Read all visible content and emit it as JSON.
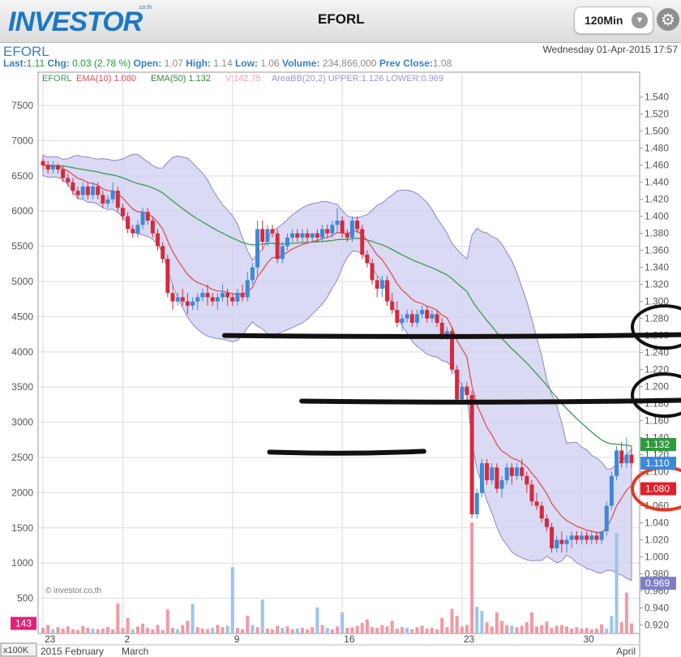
{
  "app": {
    "logo": "INVESTOR",
    "logo_sub": ".co.th",
    "title": "EFORL",
    "timeframe": "120Min",
    "timeframe_icon": "chevron-down-icon",
    "settings_icon": "gear-icon"
  },
  "info": {
    "symbol": "EFORL",
    "date": "Wednesday 01-Apr-2015 17:57",
    "last_label": "Last:",
    "last": "1.11",
    "chg_label": "Chg:",
    "chg": "0.03 (2.78 %)",
    "open_label": "Open:",
    "open": "1.07",
    "high_label": "High:",
    "high": "1.14",
    "low_label": "Low:",
    "low": "1.06",
    "volume_label": "Volume:",
    "volume": "234,866,000",
    "prevclose_label": "Prev Close:",
    "prevclose": "1.08"
  },
  "legend": {
    "symbol": "EFORL",
    "ema10": "EMA(10) 1.080",
    "ema50": "EMA(50) 1.132",
    "vol": "V:142.75",
    "bb": "AreaBB(20,2) UPPER:1.126 LOWER:0.969"
  },
  "colors": {
    "up": "#3d88d8",
    "down": "#d42a3c",
    "ema10": "#e0505a",
    "ema50": "#3c9a4c",
    "bb_fill": "#cfcdf0",
    "bb_edge": "#8c86c8",
    "vol_up": "#9cc4ec",
    "vol_down": "#f09aa4",
    "grid": "#dcdcdc"
  },
  "chart_data": {
    "type": "candlestick",
    "x_ticks": [
      "23",
      "2",
      "9",
      "16",
      "23",
      "30"
    ],
    "x_months": [
      "2015 February",
      "March",
      "April"
    ],
    "left_axis_ticks": [
      "7500",
      "7000",
      "6500",
      "6000",
      "5500",
      "5000",
      "4500",
      "4000",
      "3500",
      "3000",
      "2500",
      "2000",
      "1500",
      "1000",
      "500"
    ],
    "left_axis_unit": "x100K",
    "right_axis_ticks": [
      "1.540",
      "1.520",
      "1.500",
      "1.480",
      "1.460",
      "1.440",
      "1.420",
      "1.400",
      "1.380",
      "1.360",
      "1.340",
      "1.320",
      "1.300",
      "1.280",
      "1.260",
      "1.240",
      "1.220",
      "1.200",
      "1.180",
      "1.160",
      "1.140",
      "1.120",
      "1.100",
      "1.080",
      "1.060",
      "1.040",
      "1.020",
      "1.000",
      "0.980",
      "0.960",
      "0.940",
      "0.920"
    ],
    "price_range": [
      0.91,
      1.555
    ],
    "volume_range": [
      0,
      7800
    ],
    "value_tags": [
      {
        "label": "1.132",
        "value": 1.132,
        "color": "#2f9a3a"
      },
      {
        "label": "1.110",
        "value": 1.11,
        "color": "#3d88d8"
      },
      {
        "label": "1.080",
        "value": 1.08,
        "color": "#e0202a"
      },
      {
        "label": "0.969",
        "value": 0.969,
        "color": "#7f7fc8"
      }
    ],
    "volume_tag": "143",
    "watermark": "© investor.co.th",
    "annotations": {
      "hlines": [
        {
          "from": 0.29,
          "to": 1.0,
          "price": 1.26
        },
        {
          "from": 0.41,
          "to": 1.0,
          "price": 1.183
        },
        {
          "from": 0.36,
          "to": 0.6,
          "price": 1.123
        }
      ],
      "circles": [
        {
          "price": 1.27,
          "color": "#111111"
        },
        {
          "price": 1.19,
          "color": "#111111"
        },
        {
          "price": 1.08,
          "color": "#e03a20"
        }
      ]
    },
    "candles": [
      [
        1.465,
        1.47,
        1.455,
        1.46
      ],
      [
        1.46,
        1.465,
        1.45,
        1.455
      ],
      [
        1.455,
        1.465,
        1.45,
        1.46
      ],
      [
        1.46,
        1.462,
        1.45,
        1.455
      ],
      [
        1.455,
        1.46,
        1.44,
        1.445
      ],
      [
        1.445,
        1.45,
        1.435,
        1.44
      ],
      [
        1.44,
        1.445,
        1.425,
        1.43
      ],
      [
        1.43,
        1.435,
        1.42,
        1.425
      ],
      [
        1.425,
        1.44,
        1.42,
        1.435
      ],
      [
        1.435,
        1.44,
        1.42,
        1.425
      ],
      [
        1.425,
        1.44,
        1.42,
        1.435
      ],
      [
        1.435,
        1.44,
        1.42,
        1.425
      ],
      [
        1.425,
        1.43,
        1.41,
        1.415
      ],
      [
        1.415,
        1.425,
        1.41,
        1.42
      ],
      [
        1.42,
        1.44,
        1.415,
        1.43
      ],
      [
        1.43,
        1.435,
        1.405,
        1.41
      ],
      [
        1.41,
        1.415,
        1.395,
        1.4
      ],
      [
        1.4,
        1.405,
        1.38,
        1.385
      ],
      [
        1.385,
        1.39,
        1.375,
        1.38
      ],
      [
        1.38,
        1.395,
        1.375,
        1.39
      ],
      [
        1.39,
        1.41,
        1.385,
        1.405
      ],
      [
        1.405,
        1.41,
        1.39,
        1.395
      ],
      [
        1.395,
        1.4,
        1.375,
        1.38
      ],
      [
        1.38,
        1.385,
        1.36,
        1.365
      ],
      [
        1.365,
        1.37,
        1.345,
        1.35
      ],
      [
        1.35,
        1.355,
        1.305,
        1.31
      ],
      [
        1.31,
        1.32,
        1.29,
        1.3
      ],
      [
        1.3,
        1.31,
        1.295,
        1.305
      ],
      [
        1.305,
        1.315,
        1.295,
        1.3
      ],
      [
        1.3,
        1.31,
        1.285,
        1.295
      ],
      [
        1.295,
        1.305,
        1.29,
        1.3
      ],
      [
        1.3,
        1.31,
        1.29,
        1.305
      ],
      [
        1.305,
        1.315,
        1.3,
        1.31
      ],
      [
        1.31,
        1.32,
        1.295,
        1.305
      ],
      [
        1.305,
        1.31,
        1.295,
        1.3
      ],
      [
        1.3,
        1.31,
        1.29,
        1.305
      ],
      [
        1.305,
        1.32,
        1.3,
        1.31
      ],
      [
        1.31,
        1.315,
        1.295,
        1.305
      ],
      [
        1.305,
        1.31,
        1.295,
        1.3
      ],
      [
        1.3,
        1.315,
        1.295,
        1.31
      ],
      [
        1.31,
        1.32,
        1.3,
        1.305
      ],
      [
        1.305,
        1.335,
        1.3,
        1.325
      ],
      [
        1.325,
        1.345,
        1.32,
        1.34
      ],
      [
        1.34,
        1.395,
        1.33,
        1.385
      ],
      [
        1.385,
        1.395,
        1.36,
        1.37
      ],
      [
        1.37,
        1.39,
        1.365,
        1.385
      ],
      [
        1.385,
        1.39,
        1.375,
        1.38
      ],
      [
        1.38,
        1.385,
        1.345,
        1.35
      ],
      [
        1.35,
        1.37,
        1.345,
        1.365
      ],
      [
        1.365,
        1.38,
        1.36,
        1.375
      ],
      [
        1.375,
        1.385,
        1.37,
        1.38
      ],
      [
        1.38,
        1.385,
        1.37,
        1.375
      ],
      [
        1.375,
        1.385,
        1.37,
        1.38
      ],
      [
        1.38,
        1.385,
        1.37,
        1.375
      ],
      [
        1.375,
        1.38,
        1.37,
        1.38
      ],
      [
        1.38,
        1.385,
        1.37,
        1.375
      ],
      [
        1.375,
        1.39,
        1.37,
        1.385
      ],
      [
        1.385,
        1.39,
        1.375,
        1.38
      ],
      [
        1.38,
        1.395,
        1.375,
        1.39
      ],
      [
        1.39,
        1.41,
        1.38,
        1.395
      ],
      [
        1.395,
        1.4,
        1.375,
        1.38
      ],
      [
        1.38,
        1.385,
        1.37,
        1.375
      ],
      [
        1.375,
        1.4,
        1.37,
        1.395
      ],
      [
        1.395,
        1.4,
        1.38,
        1.385
      ],
      [
        1.385,
        1.39,
        1.35,
        1.355
      ],
      [
        1.355,
        1.36,
        1.34,
        1.345
      ],
      [
        1.345,
        1.35,
        1.32,
        1.325
      ],
      [
        1.325,
        1.33,
        1.305,
        1.315
      ],
      [
        1.315,
        1.33,
        1.305,
        1.325
      ],
      [
        1.325,
        1.33,
        1.295,
        1.3
      ],
      [
        1.3,
        1.31,
        1.285,
        1.29
      ],
      [
        1.29,
        1.3,
        1.27,
        1.275
      ],
      [
        1.275,
        1.285,
        1.265,
        1.28
      ],
      [
        1.28,
        1.29,
        1.275,
        1.285
      ],
      [
        1.285,
        1.29,
        1.27,
        1.275
      ],
      [
        1.275,
        1.29,
        1.27,
        1.285
      ],
      [
        1.285,
        1.295,
        1.28,
        1.29
      ],
      [
        1.29,
        1.295,
        1.275,
        1.28
      ],
      [
        1.28,
        1.29,
        1.275,
        1.285
      ],
      [
        1.285,
        1.29,
        1.27,
        1.275
      ],
      [
        1.275,
        1.28,
        1.255,
        1.26
      ],
      [
        1.26,
        1.27,
        1.255,
        1.265
      ],
      [
        1.265,
        1.27,
        1.215,
        1.22
      ],
      [
        1.22,
        1.225,
        1.18,
        1.185
      ],
      [
        1.185,
        1.205,
        1.18,
        1.2
      ],
      [
        1.2,
        1.205,
        1.185,
        1.19
      ],
      [
        1.19,
        1.195,
        1.045,
        1.05
      ],
      [
        1.05,
        1.08,
        1.045,
        1.075
      ],
      [
        1.075,
        1.115,
        1.07,
        1.11
      ],
      [
        1.11,
        1.115,
        1.085,
        1.09
      ],
      [
        1.09,
        1.11,
        1.085,
        1.105
      ],
      [
        1.105,
        1.11,
        1.075,
        1.08
      ],
      [
        1.08,
        1.095,
        1.07,
        1.09
      ],
      [
        1.09,
        1.11,
        1.085,
        1.105
      ],
      [
        1.105,
        1.11,
        1.085,
        1.095
      ],
      [
        1.095,
        1.11,
        1.09,
        1.105
      ],
      [
        1.105,
        1.115,
        1.09,
        1.095
      ],
      [
        1.095,
        1.1,
        1.075,
        1.085
      ],
      [
        1.085,
        1.09,
        1.06,
        1.065
      ],
      [
        1.065,
        1.075,
        1.055,
        1.06
      ],
      [
        1.06,
        1.065,
        1.04,
        1.045
      ],
      [
        1.045,
        1.05,
        1.03,
        1.035
      ],
      [
        1.035,
        1.04,
        1.005,
        1.01
      ],
      [
        1.01,
        1.025,
        1.005,
        1.02
      ],
      [
        1.02,
        1.03,
        1.005,
        1.015
      ],
      [
        1.015,
        1.025,
        1.005,
        1.02
      ],
      [
        1.02,
        1.03,
        1.01,
        1.025
      ],
      [
        1.025,
        1.03,
        1.015,
        1.02
      ],
      [
        1.02,
        1.03,
        1.015,
        1.025
      ],
      [
        1.025,
        1.03,
        1.015,
        1.02
      ],
      [
        1.02,
        1.03,
        1.015,
        1.025
      ],
      [
        1.025,
        1.03,
        1.015,
        1.02
      ],
      [
        1.02,
        1.03,
        1.015,
        1.03
      ],
      [
        1.03,
        1.065,
        1.025,
        1.06
      ],
      [
        1.06,
        1.1,
        1.055,
        1.095
      ],
      [
        1.095,
        1.13,
        1.09,
        1.125
      ],
      [
        1.125,
        1.135,
        1.105,
        1.11
      ],
      [
        1.11,
        1.14,
        1.105,
        1.12
      ],
      [
        1.12,
        1.13,
        1.105,
        1.11
      ]
    ],
    "volume": [
      [
        80,
        0
      ],
      [
        120,
        0
      ],
      [
        60,
        1
      ],
      [
        90,
        0
      ],
      [
        70,
        0
      ],
      [
        100,
        0
      ],
      [
        60,
        0
      ],
      [
        50,
        0
      ],
      [
        110,
        0
      ],
      [
        80,
        0
      ],
      [
        70,
        1
      ],
      [
        60,
        0
      ],
      [
        70,
        0
      ],
      [
        90,
        0
      ],
      [
        60,
        0
      ],
      [
        430,
        0
      ],
      [
        80,
        0
      ],
      [
        220,
        0
      ],
      [
        60,
        1
      ],
      [
        100,
        0
      ],
      [
        140,
        0
      ],
      [
        80,
        0
      ],
      [
        60,
        0
      ],
      [
        120,
        0
      ],
      [
        50,
        0
      ],
      [
        340,
        0
      ],
      [
        80,
        0
      ],
      [
        60,
        1
      ],
      [
        120,
        0
      ],
      [
        180,
        0
      ],
      [
        420,
        1
      ],
      [
        90,
        0
      ],
      [
        70,
        0
      ],
      [
        60,
        0
      ],
      [
        80,
        1
      ],
      [
        120,
        0
      ],
      [
        90,
        0
      ],
      [
        110,
        1
      ],
      [
        940,
        1
      ],
      [
        80,
        0
      ],
      [
        60,
        0
      ],
      [
        250,
        0
      ],
      [
        120,
        1
      ],
      [
        90,
        0
      ],
      [
        480,
        1
      ],
      [
        70,
        0
      ],
      [
        60,
        0
      ],
      [
        110,
        0
      ],
      [
        80,
        1
      ],
      [
        100,
        0
      ],
      [
        60,
        0
      ],
      [
        70,
        1
      ],
      [
        80,
        0
      ],
      [
        60,
        0
      ],
      [
        90,
        0
      ],
      [
        370,
        1
      ],
      [
        120,
        0
      ],
      [
        80,
        1
      ],
      [
        60,
        0
      ],
      [
        100,
        0
      ],
      [
        300,
        1
      ],
      [
        80,
        0
      ],
      [
        90,
        0
      ],
      [
        110,
        0
      ],
      [
        150,
        0
      ],
      [
        200,
        0
      ],
      [
        90,
        0
      ],
      [
        80,
        0
      ],
      [
        120,
        0
      ],
      [
        100,
        0
      ],
      [
        180,
        0
      ],
      [
        70,
        0
      ],
      [
        90,
        0
      ],
      [
        80,
        1
      ],
      [
        60,
        0
      ],
      [
        90,
        0
      ],
      [
        110,
        0
      ],
      [
        70,
        0
      ],
      [
        80,
        0
      ],
      [
        60,
        0
      ],
      [
        220,
        0
      ],
      [
        90,
        0
      ],
      [
        350,
        0
      ],
      [
        250,
        0
      ],
      [
        100,
        0
      ],
      [
        120,
        0
      ],
      [
        1580,
        0
      ],
      [
        380,
        1
      ],
      [
        320,
        1
      ],
      [
        160,
        0
      ],
      [
        100,
        0
      ],
      [
        300,
        0
      ],
      [
        180,
        0
      ],
      [
        120,
        0
      ],
      [
        110,
        1
      ],
      [
        90,
        0
      ],
      [
        110,
        0
      ],
      [
        160,
        0
      ],
      [
        300,
        0
      ],
      [
        100,
        0
      ],
      [
        120,
        0
      ],
      [
        170,
        0
      ],
      [
        80,
        0
      ],
      [
        110,
        0
      ],
      [
        120,
        0
      ],
      [
        100,
        0
      ],
      [
        70,
        0
      ],
      [
        90,
        0
      ],
      [
        70,
        0
      ],
      [
        80,
        0
      ],
      [
        60,
        0
      ],
      [
        70,
        0
      ],
      [
        130,
        0
      ],
      [
        70,
        1
      ],
      [
        250,
        1
      ],
      [
        1430,
        1
      ],
      [
        160,
        0
      ],
      [
        580,
        0
      ],
      [
        143,
        0
      ]
    ]
  }
}
